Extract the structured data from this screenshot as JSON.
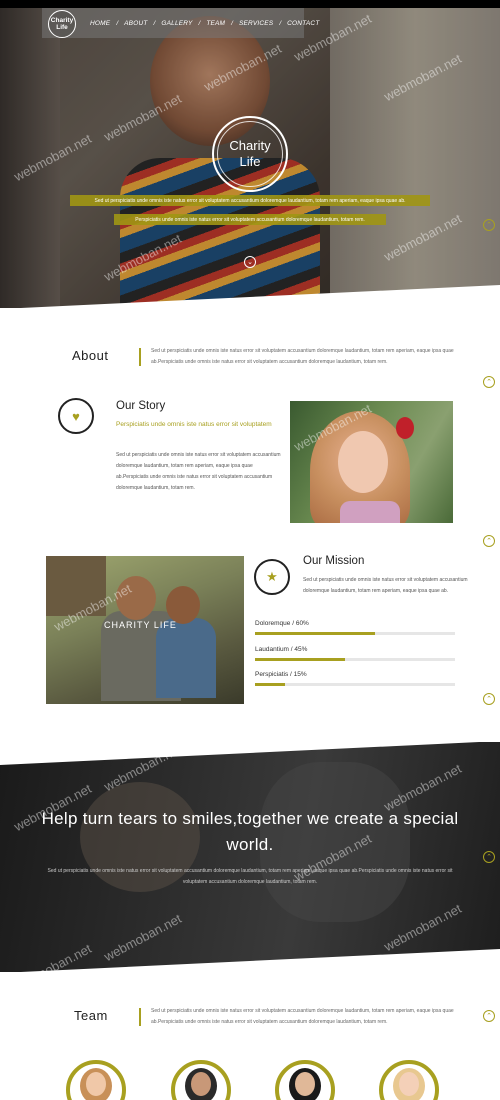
{
  "nav": {
    "logo_line1": "Charity",
    "logo_line2": "Life",
    "items": [
      "HOME",
      "ABOUT",
      "GALLERY",
      "TEAM",
      "SERVICES",
      "CONTACT"
    ]
  },
  "hero": {
    "logo_line1": "Charity",
    "logo_line2": "Life",
    "strip1": "Sed ut perspiciatis unde omnis iste natus error sit voluptatem accusantium doloremque laudantium, totam rem aperiam, eaque ipsa quae ab.",
    "strip2": "Perspiciatis unde omnis iste natus error sit voluptatem accusantium doloremque laudantium, totam rem."
  },
  "watermark": "webmoban.net",
  "about": {
    "title": "About",
    "text": "Sed ut perspiciatis unde omnis iste natus error sit voluptatem accusantium doloremque laudantium, totam rem aperiam, eaque ipsa quae ab.Perspiciatis unde omnis iste natus error sit voluptatem accusantium doloremque laudantium, totam rem."
  },
  "story": {
    "title": "Our Story",
    "subtitle": "Perspiciatis unde omnis iste natus error sit voluptatem",
    "text": "Sed ut perspiciatis unde omnis iste natus error sit voluptatem accusantium doloremque laudantium, totam rem aperiam, eaque ipsa quae ab.Perspiciatis unde omnis iste natus error sit voluptatem accusantium doloremque laudantium, totam rem."
  },
  "mission": {
    "photo_watermark": "CHARITY LIFE",
    "title": "Our Mission",
    "text": "Sed ut perspiciatis unde omnis iste natus error sit voluptatem accusantium doloremque laudantium, totam rem aperiam, eaque ipsa quae ab.Perspiciatis unde omnis iste natus error sit voluptatem accusantium doloremque laudantium, totam rem aperiam, eaque ipsa quae ab.",
    "mission_text": "Sed ut perspiciatis unde omnis iste natus error sit voluptatem accusantium doloremque laudantium, totam rem aperiam, eaque ipsa quae ab.",
    "progress": [
      {
        "label": "Doloremque / 60%",
        "value": 0.6
      },
      {
        "label": "Laudantium / 45%",
        "value": 0.45
      },
      {
        "label": "Perspiciatis / 15%",
        "value": 0.15
      }
    ]
  },
  "banner": {
    "heading": "Help turn tears to smiles,together we create a special world.",
    "text": "Sed ut perspiciatis unde omnis iste natus error sit voluptatem accusantium doloremque laudantium, totam rem aperiam, eaque ipsa quae ab.Perspiciatis unde omnis iste natus error sit voluptatem accusantium doloremque laudantium, totam rem."
  },
  "team": {
    "title": "Team",
    "text": "Sed ut perspiciatis unde omnis iste natus error sit voluptatem accusantium doloremque laudantium, totam rem aperiam, eaque ipsa quae ab.Perspiciatis unde omnis iste natus error sit voluptatem accusantium doloremque laudantium, totam rem."
  },
  "colors": {
    "accent": "#a8a020",
    "dark": "#222222"
  },
  "icons": {
    "heart": "heart-icon",
    "star": "star-icon",
    "chevron_down": "chevron-down-icon",
    "chevron_up": "chevron-up-icon"
  }
}
